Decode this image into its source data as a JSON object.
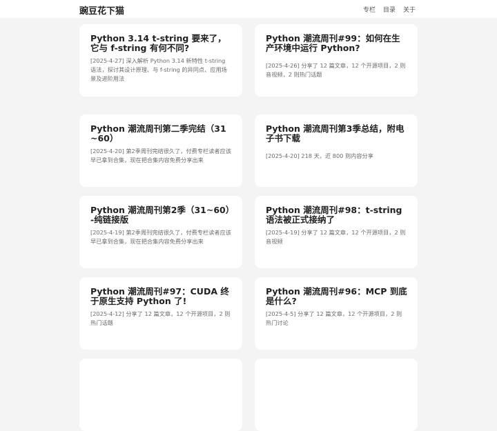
{
  "header": {
    "site_title": "豌豆花下猫",
    "nav": [
      "专栏",
      "目录",
      "关于"
    ]
  },
  "posts": [
    {
      "title": "Python 3.14 t-string 要来了，它与 f-string 有何不同?",
      "desc": "[2025-4-27] 深入解析 Python 3.14 新特性 t-string 语法，探讨其设计原理、与 f-string 的异同点、应用场景及进阶用法"
    },
    {
      "title": "Python 潮流周刊#99：如何在生产环境中运行 Python?",
      "desc": "[2025-4-26] 分享了 12 篇文章，12 个开源项目，2 则音视频，2 则热门话题"
    },
    {
      "title": "Python 潮流周刊第二季完结（31~60）",
      "desc": "[2025-4-20] 第2季周刊完结很久了，付费专栏读者应该早已拿到合集，现在把合集内容免费分享出来"
    },
    {
      "title": "Python 潮流周刊第3季总结，附电子书下载",
      "desc": "[2025-4-20] 218 天，近 800 则内容分享"
    },
    {
      "title": "Python 潮流周刊第2季（31~60）-纯链接版",
      "desc": "[2025-4-19] 第2季周刊完结很久了，付费专栏读者应该早已拿到合集，现在把合集内容免费分享出来"
    },
    {
      "title": "Python 潮流周刊#98：t-string 语法被正式接纳了",
      "desc": "[2025-4-19] 分享了 12 篇文章，12 个开源项目，2 则音视频"
    },
    {
      "title": "Python 潮流周刊#97：CUDA 终于原生支持 Python 了!",
      "desc": "[2025-4-12] 分享了 12 篇文章，12 个开源项目，2 则热门话题"
    },
    {
      "title": "Python 潮流周刊#96：MCP 到底是什么?",
      "desc": "[2025-4-5] 分享了 12 篇文章，12 个开源项目，2 则热门讨论"
    }
  ]
}
